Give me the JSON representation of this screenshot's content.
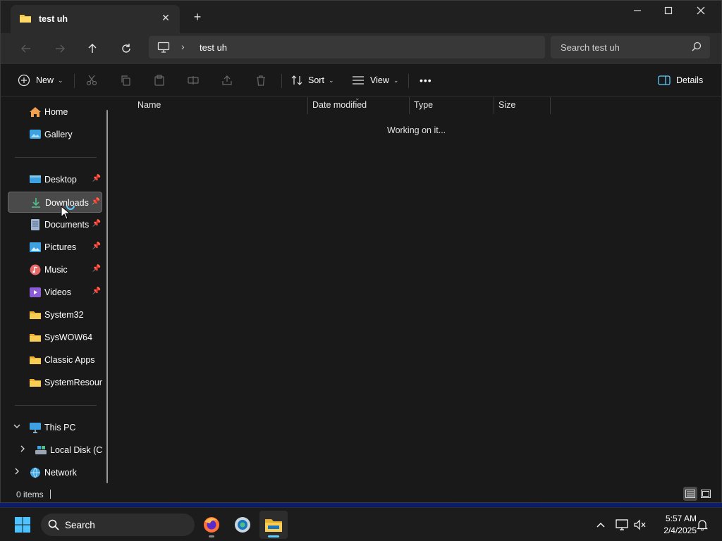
{
  "window": {
    "tab_title": "test uh",
    "new_tab": "+",
    "close_tab": "✕",
    "minimize": "—",
    "maximize": "☐",
    "close": "✕"
  },
  "address": {
    "path": "test uh",
    "search_placeholder": "Search test uh"
  },
  "commandbar": {
    "new_label": "New",
    "sort_label": "Sort",
    "view_label": "View",
    "more_label": "•••",
    "details_label": "Details"
  },
  "sidebar": {
    "items": [
      {
        "label": "Home",
        "icon": "home-icon",
        "pinned": false
      },
      {
        "label": "Gallery",
        "icon": "gallery-icon",
        "pinned": false
      },
      {
        "label": "Desktop",
        "icon": "desktop-icon",
        "pinned": true
      },
      {
        "label": "Downloads",
        "icon": "download-icon",
        "pinned": true,
        "selected": true
      },
      {
        "label": "Documents",
        "icon": "documents-icon",
        "pinned": true
      },
      {
        "label": "Pictures",
        "icon": "pictures-icon",
        "pinned": true
      },
      {
        "label": "Music",
        "icon": "music-icon",
        "pinned": true
      },
      {
        "label": "Videos",
        "icon": "videos-icon",
        "pinned": true
      },
      {
        "label": "System32",
        "icon": "folder-icon",
        "pinned": false
      },
      {
        "label": "SysWOW64",
        "icon": "folder-icon",
        "pinned": false
      },
      {
        "label": "Classic Apps",
        "icon": "folder-icon",
        "pinned": false
      },
      {
        "label": "SystemResourc",
        "icon": "folder-icon",
        "pinned": false
      }
    ],
    "this_pc": "This PC",
    "local_disk": "Local Disk (C:",
    "network": "Network"
  },
  "columns": {
    "name": "Name",
    "date_modified": "Date modified",
    "type": "Type",
    "size": "Size"
  },
  "content": {
    "status_message": "Working on it..."
  },
  "statusbar": {
    "items_count": "0 items"
  },
  "taskbar": {
    "search_label": "Search",
    "time": "5:57 AM",
    "date": "2/4/2025"
  },
  "colors": {
    "accent": "#60cdff",
    "folder_yellow": "#f4c542",
    "window_bg": "#191919"
  }
}
